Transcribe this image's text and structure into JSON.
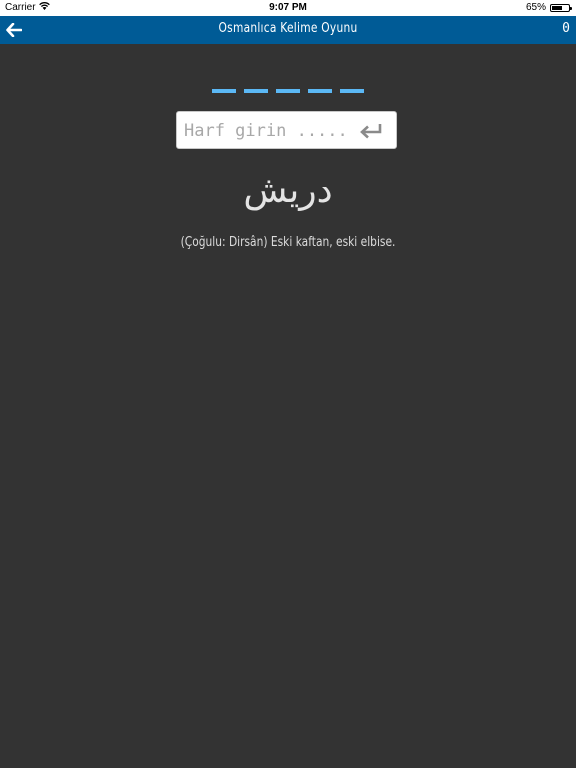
{
  "status_bar": {
    "carrier": "Carrier",
    "time": "9:07 PM",
    "battery_percent": "65%",
    "battery_level": 0.65
  },
  "nav": {
    "back_icon": "arrow-left-icon",
    "title": "Osmanlıca Kelime Oyunu",
    "score": "0"
  },
  "game": {
    "letter_count": 5,
    "input_placeholder": "Harf girin ......",
    "input_value": "",
    "enter_icon": "return-arrow-icon",
    "word": "دريش",
    "meaning": "(Çoğulu: Dirsân) Eski kaftan, eski elbise."
  },
  "colors": {
    "nav_background": "#005b96",
    "page_background": "#333333",
    "dash_color": "#5bb8f5"
  }
}
